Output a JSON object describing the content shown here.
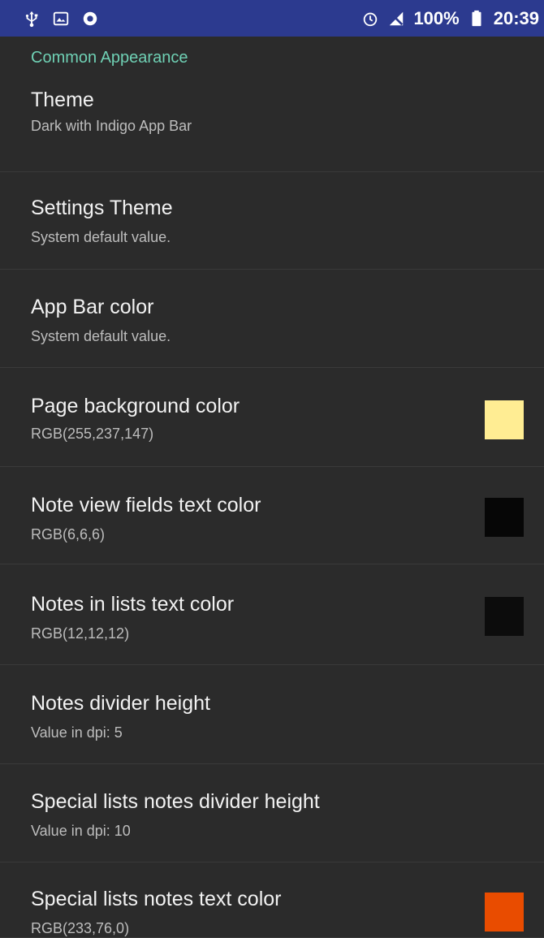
{
  "status_bar": {
    "icons_left": [
      "usb-icon",
      "image-icon",
      "sync-icon"
    ],
    "icons_right": [
      "alarm-icon",
      "no-signal-icon"
    ],
    "battery": "100%",
    "time": "20:39"
  },
  "section": {
    "title": "Common Appearance"
  },
  "preferences": [
    {
      "title": "Theme",
      "summary": "Dark with Indigo App Bar"
    },
    {
      "title": "Settings Theme",
      "summary": "System default value."
    },
    {
      "title": "App Bar color",
      "summary": "System default value."
    },
    {
      "title": "Page background color",
      "summary": "RGB(255,237,147)",
      "color": "#ffed93"
    },
    {
      "title": "Note view fields text color",
      "summary": "RGB(6,6,6)",
      "color": "#060606"
    },
    {
      "title": "Notes in lists text color",
      "summary": "RGB(12,12,12)",
      "color": "#0c0c0c"
    },
    {
      "title": "Notes divider height",
      "summary": "Value in dpi: 5"
    },
    {
      "title": "Special lists notes divider height",
      "summary": "Value in dpi: 10"
    },
    {
      "title": "Special lists notes text color",
      "summary": "RGB(233,76,0)",
      "color": "#e94c00"
    }
  ]
}
